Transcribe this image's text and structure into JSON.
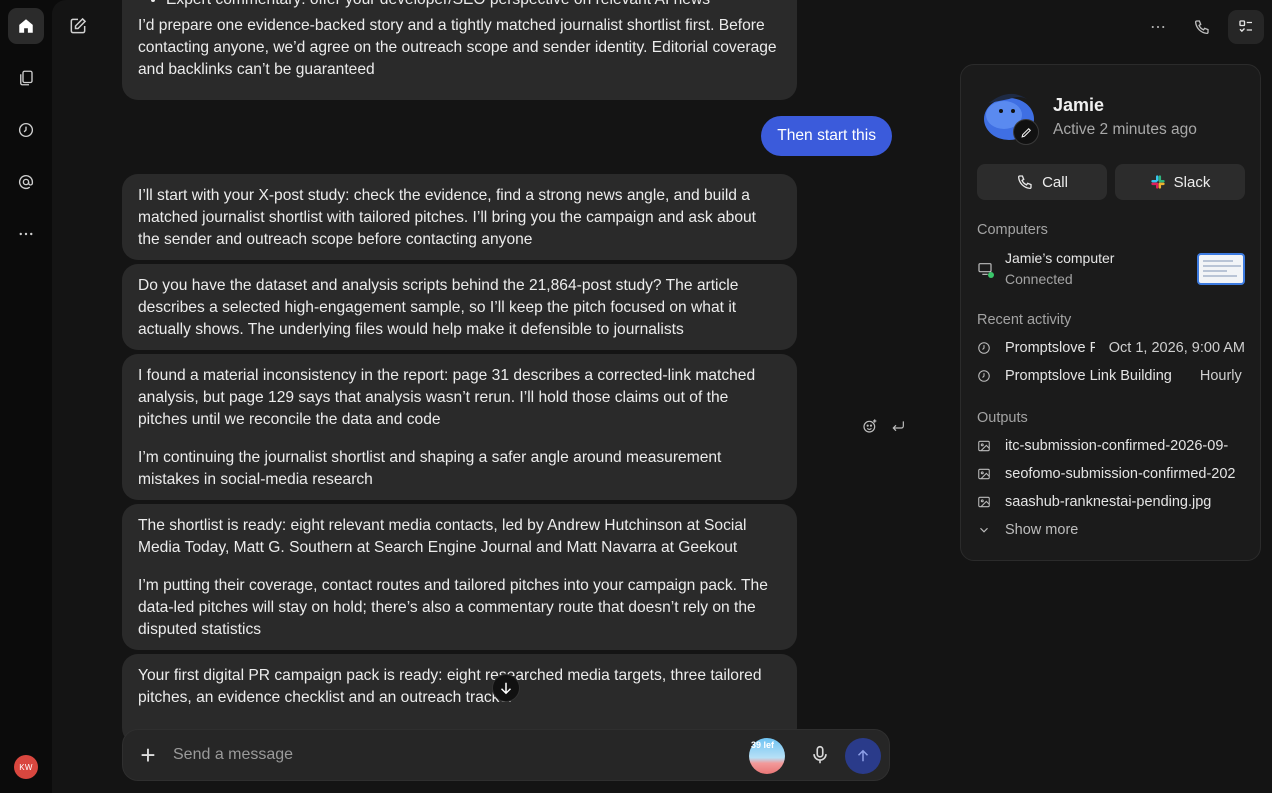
{
  "sidebar": {
    "items": [
      {
        "name": "home-icon"
      },
      {
        "name": "documents-icon"
      },
      {
        "name": "history-icon"
      },
      {
        "name": "mentions-icon"
      },
      {
        "name": "more-icon"
      }
    ],
    "user_initials": "KW"
  },
  "chat": {
    "messages": [
      {
        "role": "assistant",
        "bullet": "Expert commentary: offer your developer/SEO perspective on relevant AI news",
        "paragraph": "I’d prepare one evidence-backed story and a tightly matched journalist shortlist first. Before contacting anyone, we’d agree on the outreach scope and sender identity. Editorial coverage and backlinks can’t be guaranteed"
      },
      {
        "role": "user",
        "text": "Then start this"
      },
      {
        "role": "assistant",
        "text": "I’ll start with your X-post study: check the evidence, find a strong news angle, and build a matched journalist shortlist with tailored pitches. I’ll bring you the campaign and ask about the sender and outreach scope before contacting anyone"
      },
      {
        "role": "assistant",
        "text": "Do you have the dataset and analysis scripts behind the 21,864-post study? The article describes a selected high-engagement sample, so I’ll keep the pitch focused on what it actually shows. The underlying files would help make it defensible to journalists"
      },
      {
        "role": "assistant",
        "p1": "I found a material inconsistency in the report: page 31 describes a corrected-link matched analysis, but page 129 says that analysis wasn’t rerun. I’ll hold those claims out of the pitches until we reconcile the data and code",
        "p2": "I’m continuing the journalist shortlist and shaping a safer angle around measurement mistakes in social-media research"
      },
      {
        "role": "assistant",
        "p1": "The shortlist is ready: eight relevant media contacts, led by Andrew Hutchinson at Social Media Today, Matt G. Southern at Search Engine Journal and Matt Navarra at Geekout",
        "p2": "I’m putting their coverage, contact routes and tailored pitches into your campaign pack. The data-led pitches will stay on hold; there’s also a commentary route that doesn’t rely on the disputed statistics"
      },
      {
        "role": "assistant",
        "text": "Your first digital PR campaign pack is ready: eight researched media targets, three tailored pitches, an evidence checklist and an outreach tracker"
      }
    ]
  },
  "composer": {
    "placeholder": "Send a message",
    "credits_badge": "39 lef"
  },
  "agent": {
    "name": "Jamie",
    "status": "Active 2 minutes ago",
    "call_label": "Call",
    "slack_label": "Slack",
    "computers_title": "Computers",
    "computer_name": "Jamie’s computer",
    "computer_status": "Connected",
    "recent_title": "Recent activity",
    "recent": [
      {
        "name": "Promptslove Pr",
        "meta": "Oct 1, 2026, 9:00 AM"
      },
      {
        "name": "Promptslove Link Building",
        "meta": "Hourly"
      }
    ],
    "outputs_title": "Outputs",
    "outputs": [
      "itc-submission-confirmed-2026-09-",
      "seofomo-submission-confirmed-202",
      "saashub-ranknestai-pending.jpg"
    ],
    "show_more": "Show more"
  },
  "colors": {
    "user_bubble": "#3b5bdb",
    "send_button": "#2a3b8a",
    "online": "#3ac56a"
  }
}
